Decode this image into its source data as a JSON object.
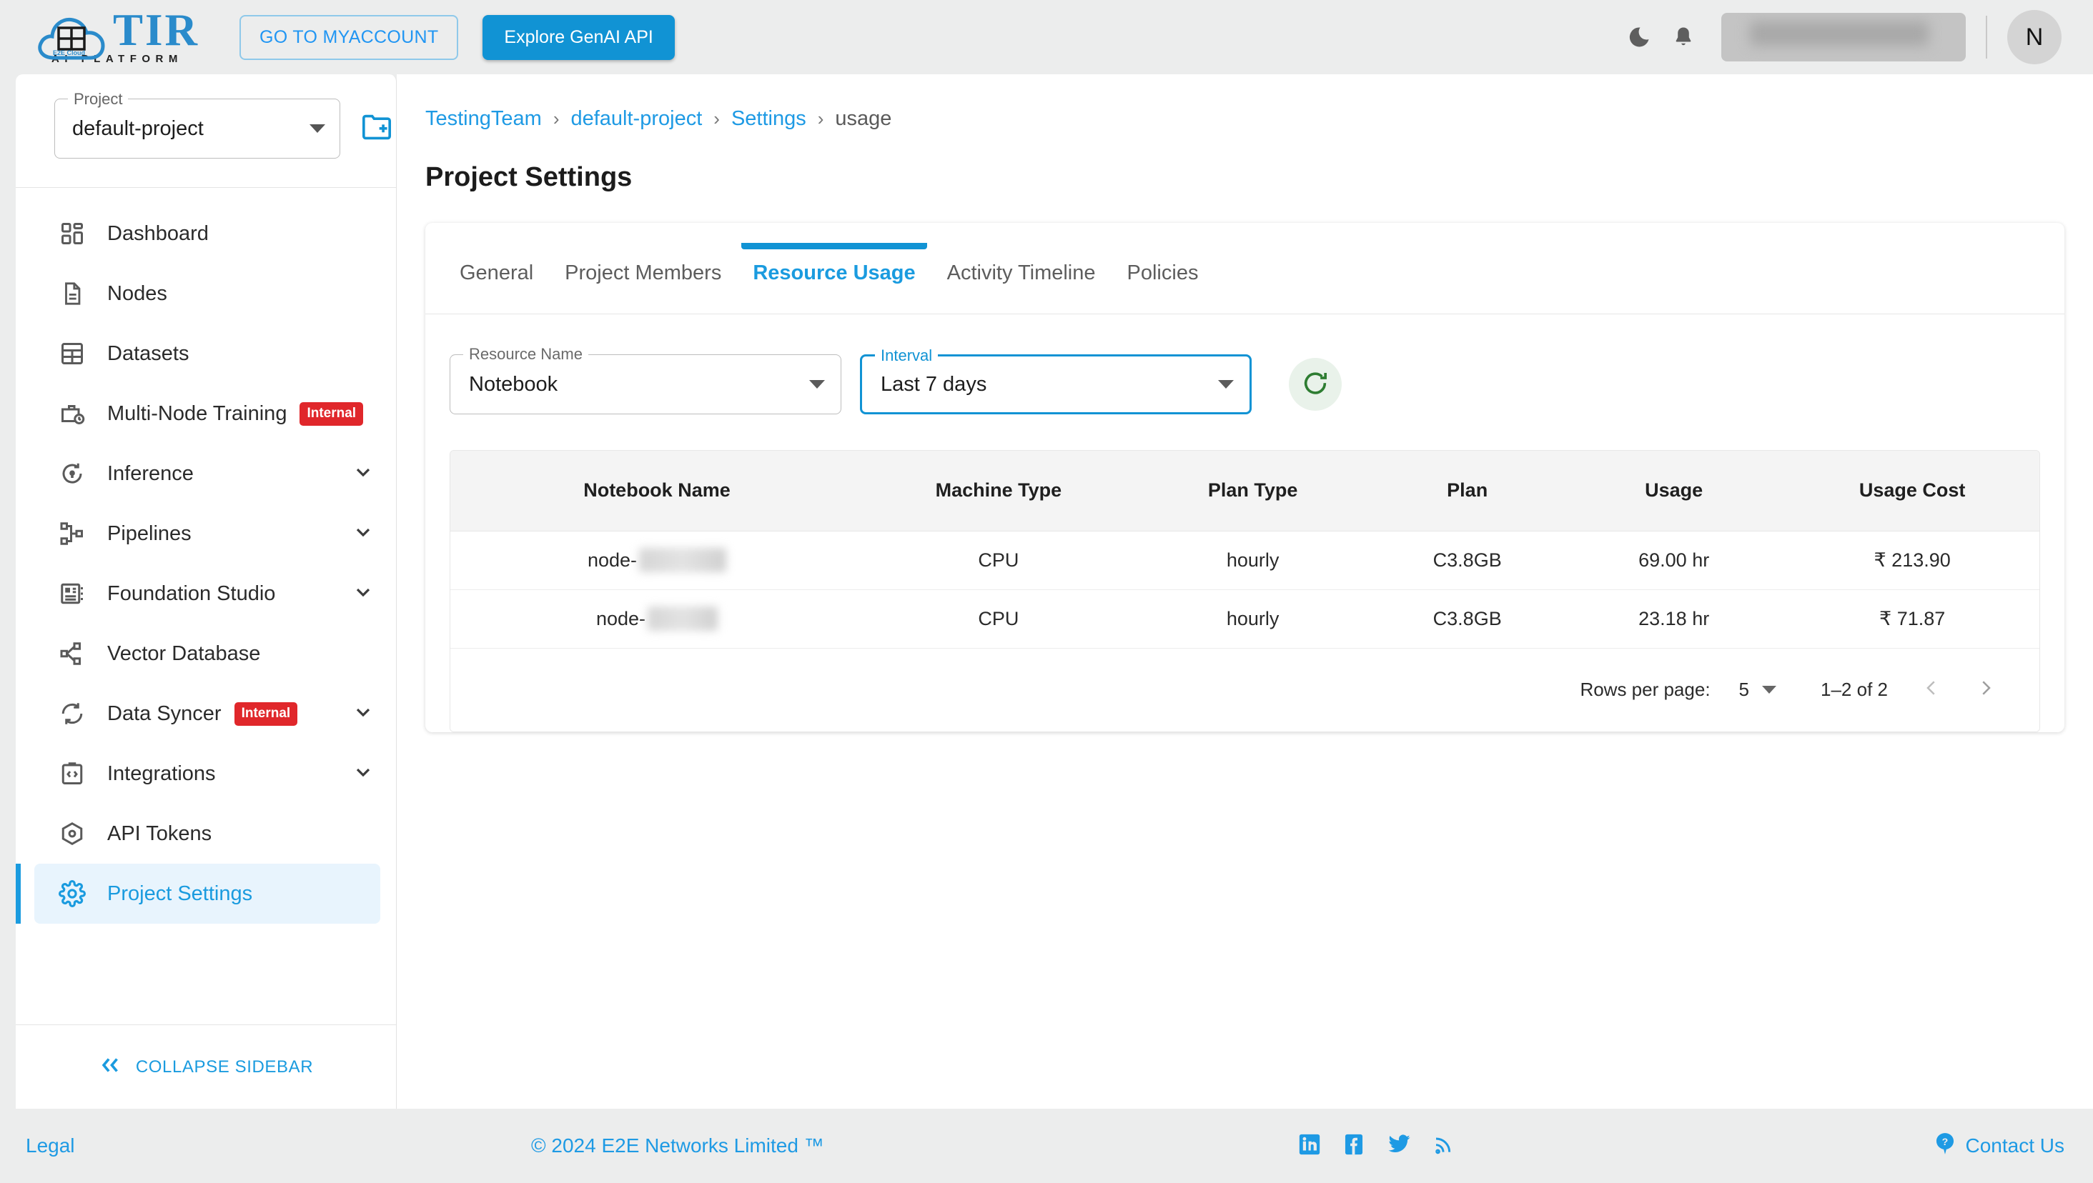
{
  "header": {
    "logo_main": "TIR",
    "logo_sub": "AI PLATFORM",
    "logo_cloud_label": "E2E Cloud",
    "myaccount_label": "GO TO MYACCOUNT",
    "genai_label": "Explore GenAI API",
    "dark_mode_icon": "moon-icon",
    "notification_icon": "bell-icon",
    "account_blurred": "",
    "avatar_initial": "N"
  },
  "sidebar": {
    "project_label": "Project",
    "project_value": "default-project",
    "new_project_icon": "new-folder-icon",
    "items": [
      {
        "label": "Dashboard",
        "icon": "dashboard-icon",
        "badge": null,
        "chevron": false,
        "active": false
      },
      {
        "label": "Nodes",
        "icon": "document-icon",
        "badge": null,
        "chevron": false,
        "active": false
      },
      {
        "label": "Datasets",
        "icon": "grid-table-icon",
        "badge": null,
        "chevron": false,
        "active": false
      },
      {
        "label": "Multi-Node Training",
        "icon": "briefcase-clock-icon",
        "badge": "Internal",
        "chevron": false,
        "active": false
      },
      {
        "label": "Inference",
        "icon": "inference-icon",
        "badge": null,
        "chevron": true,
        "active": false
      },
      {
        "label": "Pipelines",
        "icon": "pipelines-icon",
        "badge": null,
        "chevron": true,
        "active": false
      },
      {
        "label": "Foundation Studio",
        "icon": "foundation-icon",
        "badge": null,
        "chevron": true,
        "active": false
      },
      {
        "label": "Vector Database",
        "icon": "vector-db-icon",
        "badge": null,
        "chevron": false,
        "active": false
      },
      {
        "label": "Data Syncer",
        "icon": "sync-icon",
        "badge": "Internal",
        "chevron": true,
        "active": false
      },
      {
        "label": "Integrations",
        "icon": "code-clipboard-icon",
        "badge": null,
        "chevron": true,
        "active": false
      },
      {
        "label": "API Tokens",
        "icon": "cube-icon",
        "badge": null,
        "chevron": false,
        "active": false
      },
      {
        "label": "Project Settings",
        "icon": "gear-icon",
        "badge": null,
        "chevron": false,
        "active": true
      }
    ],
    "collapse_label": "COLLAPSE SIDEBAR",
    "collapse_icon": "double-chevron-left-icon"
  },
  "breadcrumb": {
    "items": [
      "TestingTeam",
      "default-project",
      "Settings",
      "usage"
    ],
    "separator": "›"
  },
  "page": {
    "title": "Project Settings"
  },
  "tabs": [
    {
      "label": "General",
      "active": false
    },
    {
      "label": "Project Members",
      "active": false
    },
    {
      "label": "Resource Usage",
      "active": true
    },
    {
      "label": "Activity Timeline",
      "active": false
    },
    {
      "label": "Policies",
      "active": false
    }
  ],
  "filters": {
    "resource_name": {
      "label": "Resource Name",
      "value": "Notebook",
      "focused": false
    },
    "interval": {
      "label": "Interval",
      "value": "Last 7 days",
      "focused": true
    },
    "refresh_icon": "refresh-icon"
  },
  "table": {
    "columns": [
      "Notebook Name",
      "Machine Type",
      "Plan Type",
      "Plan",
      "Usage",
      "Usage Cost"
    ],
    "rows": [
      {
        "name_prefix": "node-",
        "name_redacted": true,
        "machine_type": "CPU",
        "plan_type": "hourly",
        "plan": "C3.8GB",
        "usage": "69.00 hr",
        "usage_cost": "₹ 213.90"
      },
      {
        "name_prefix": "node-",
        "name_redacted": true,
        "machine_type": "CPU",
        "plan_type": "hourly",
        "plan": "C3.8GB",
        "usage": "23.18 hr",
        "usage_cost": "₹ 71.87"
      }
    ]
  },
  "pagination": {
    "rows_per_page_label": "Rows per page:",
    "rows_per_page_value": "5",
    "range_label": "1–2 of 2",
    "prev_icon": "chevron-left-icon",
    "next_icon": "chevron-right-icon"
  },
  "footer": {
    "legal": "Legal",
    "copyright": "© 2024 E2E Networks Limited ™",
    "social": [
      "linkedin-icon",
      "facebook-icon",
      "twitter-icon",
      "rss-icon"
    ],
    "contact": "Contact Us",
    "contact_icon": "question-mark-icon"
  },
  "colors": {
    "accent_blue": "#1193d4",
    "link_blue": "#1e9ae4",
    "badge_red": "#e0272b",
    "refresh_green": "#2e7d32",
    "page_bg": "#eceded"
  }
}
